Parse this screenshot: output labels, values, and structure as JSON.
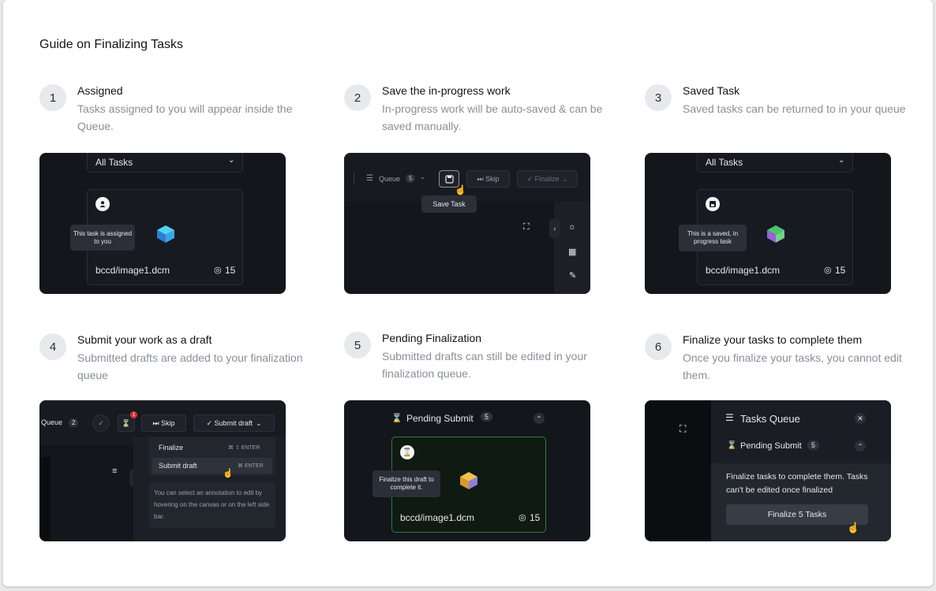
{
  "title": "Guide on Finalizing Tasks",
  "steps": [
    {
      "num": "1",
      "title": "Assigned",
      "desc": "Tasks assigned to you will appear inside the Queue."
    },
    {
      "num": "2",
      "title": "Save the in-progress work",
      "desc": "In-progress work will be auto-saved & can be saved manually."
    },
    {
      "num": "3",
      "title": "Saved Task",
      "desc": "Saved tasks can be returned to in your queue"
    },
    {
      "num": "4",
      "title": "Submit your work as a draft",
      "desc": "Submitted drafts are added to your finalization queue"
    },
    {
      "num": "5",
      "title": "Pending Finalization",
      "desc": "Submitted drafts can still be edited in your finalization queue."
    },
    {
      "num": "6",
      "title": "Finalize your tasks to complete them",
      "desc": "Once you finalize your tasks, you cannot edit them."
    }
  ],
  "shot1": {
    "dropdown": "All Tasks",
    "tooltip": "This task is assigned to you",
    "filename": "bccd/image1.dcm",
    "count": "15"
  },
  "shot2": {
    "queue": "Queue",
    "queue_count": "5",
    "skip": "Skip",
    "finalize": "Finalize",
    "save_tooltip": "Save Task"
  },
  "shot3": {
    "dropdown": "All Tasks",
    "tooltip": "This is a saved, in progress task",
    "filename": "bccd/image1.dcm",
    "count": "15"
  },
  "shot4": {
    "queue": "Queue",
    "queue_count": "2",
    "badge": "1",
    "skip": "Skip",
    "submit_draft": "Submit draft",
    "menu": [
      {
        "label": "Finalize",
        "shortcut": "⌘ ⇧ ENTER"
      },
      {
        "label": "Submit draft",
        "shortcut": "⌘ ENTER"
      }
    ],
    "hint": "You can select an annotation to edit by hovering on the canvas or on the left side bar."
  },
  "shot5": {
    "header": "Pending Submit",
    "count": "5",
    "tooltip": "Finalize this draft to complete it.",
    "filename": "bccd/image1.dcm",
    "views": "15"
  },
  "shot6": {
    "queue_title": "Tasks Queue",
    "pending": "Pending Submit",
    "pending_count": "5",
    "message": "Finalize tasks to complete them. Tasks can't be edited once finalized",
    "button": "Finalize 5 Tasks"
  },
  "colors": {
    "dark_bg": "#13161b",
    "panel": "#171a20",
    "green_panel": "#0f1a12",
    "accent_green": "#2f7a45"
  }
}
